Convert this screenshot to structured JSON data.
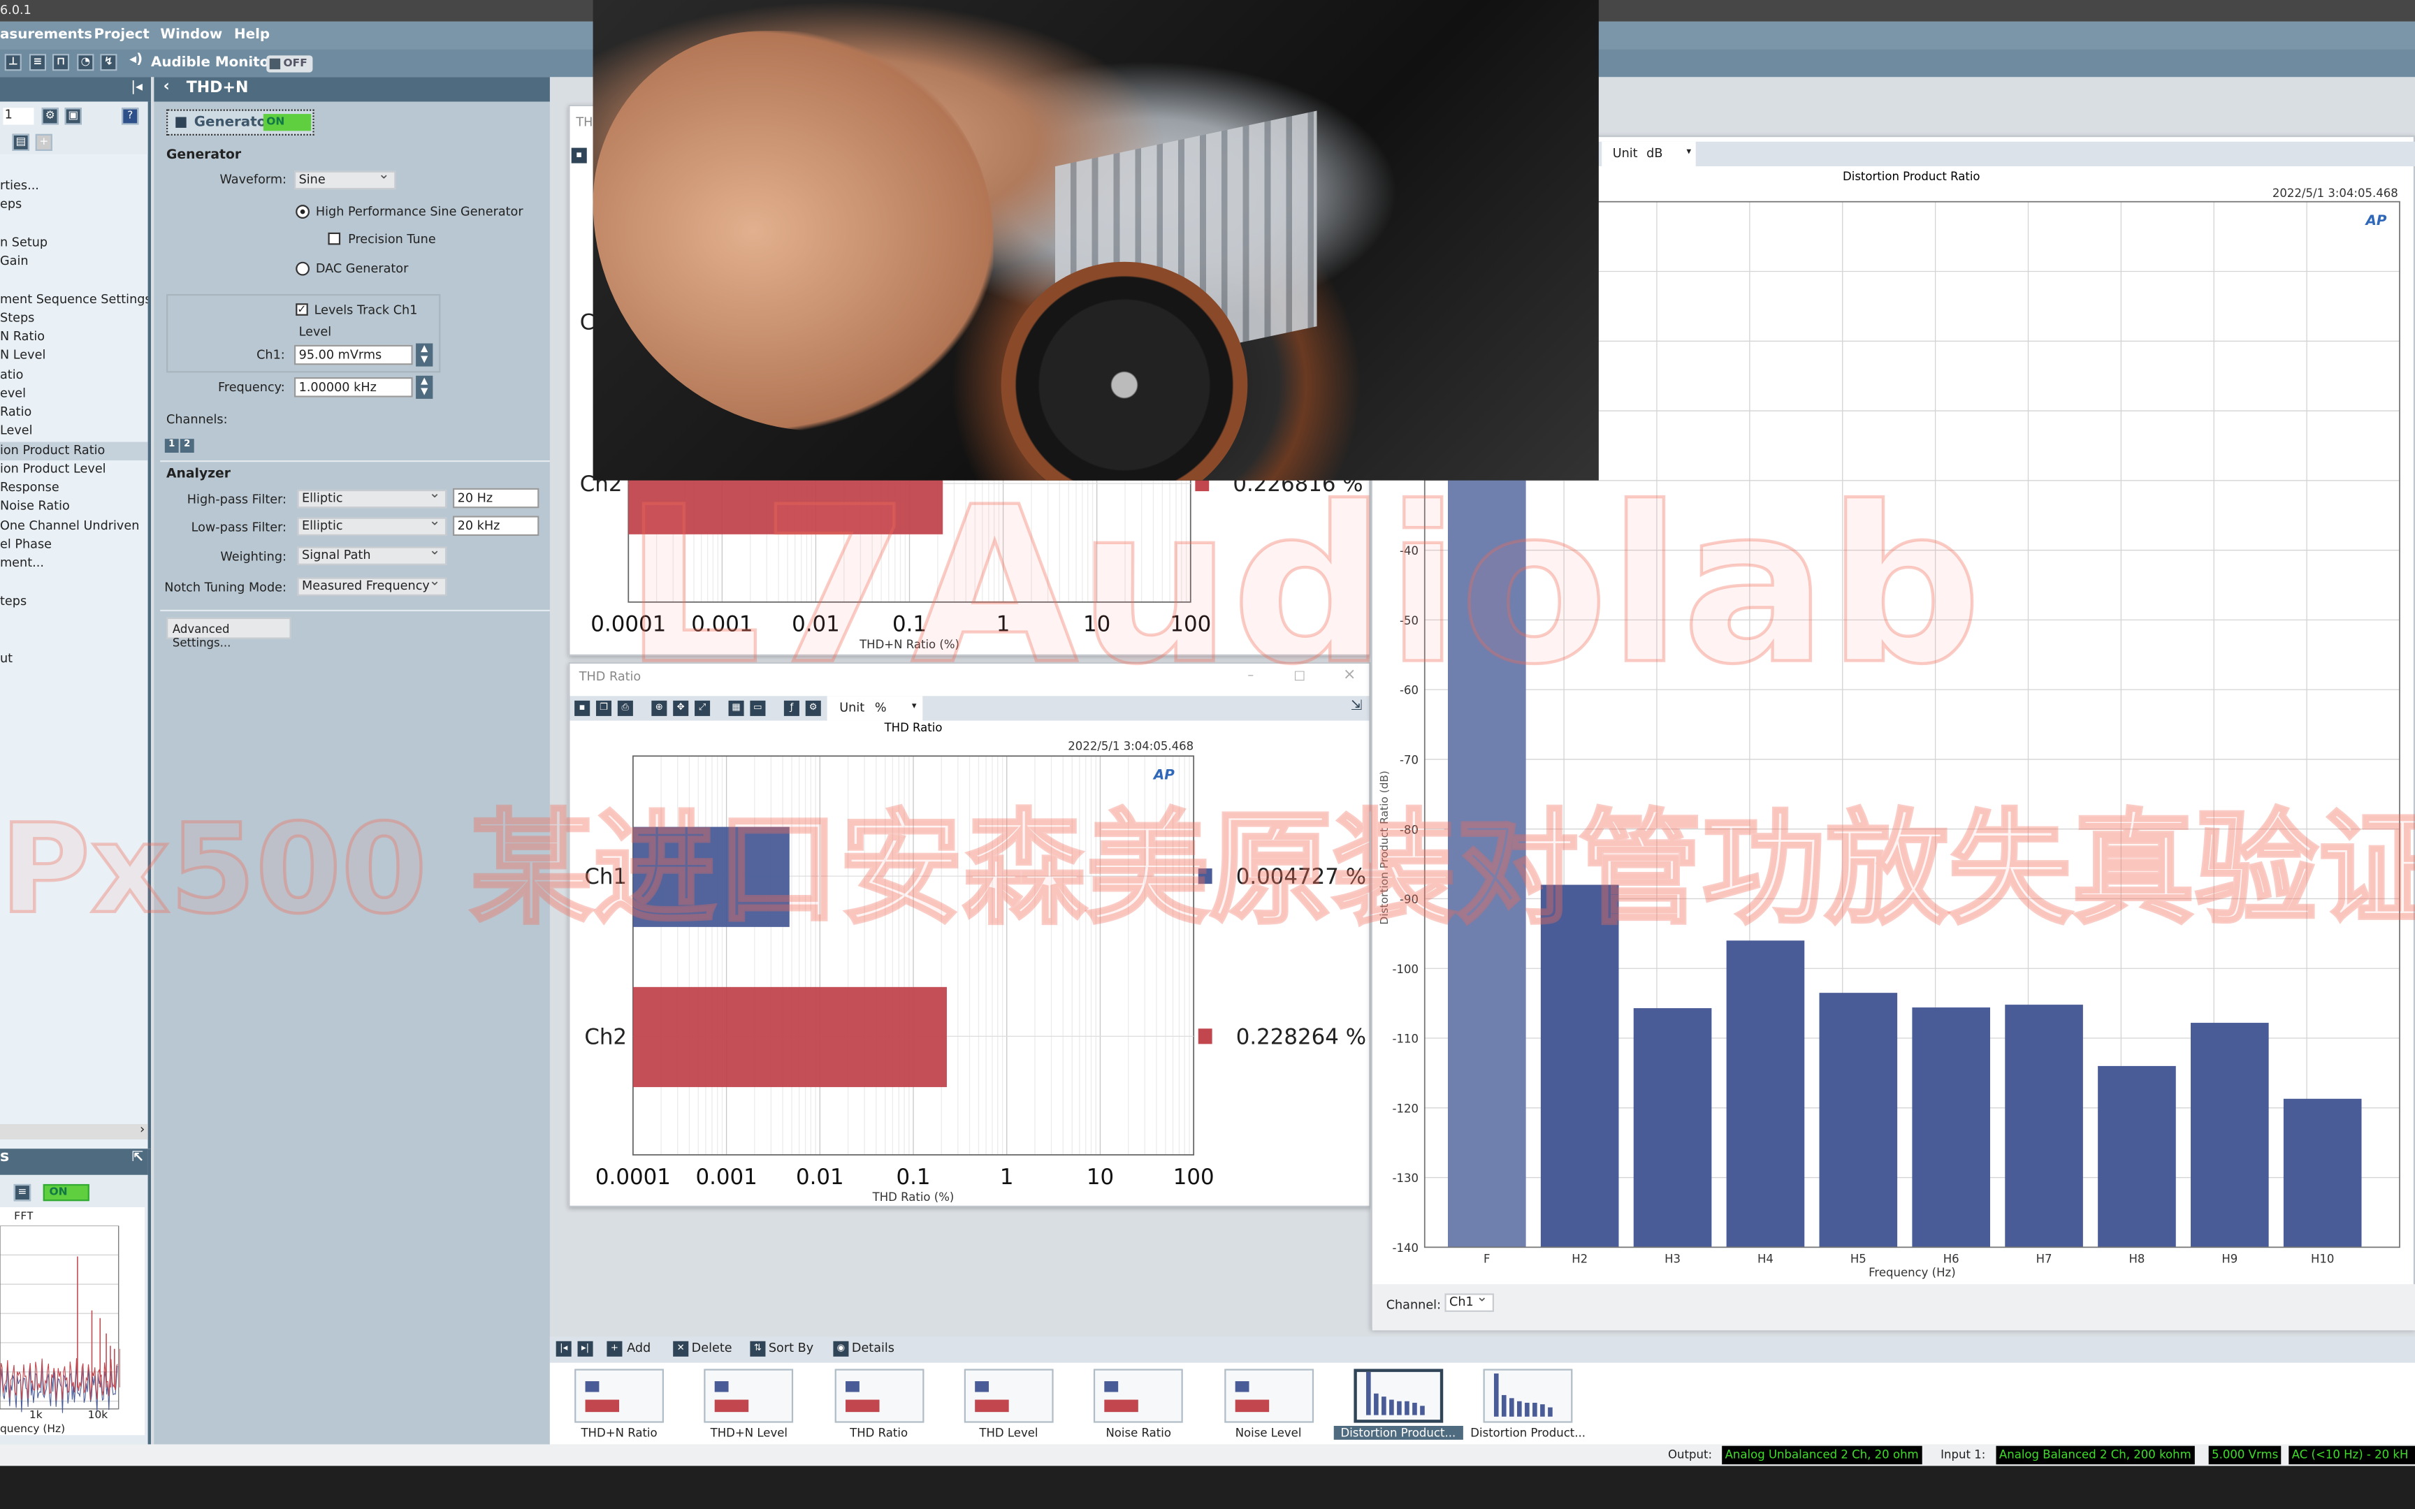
{
  "app": {
    "title": "6.0.1"
  },
  "menu": [
    "asurements",
    "Project",
    "Window",
    "Help"
  ],
  "toolbar": {
    "audible_monitor": "Audible Monitor",
    "audible_toggle": "OFF"
  },
  "sidebar": {
    "items": [
      {
        "label": "rties...",
        "selected": false
      },
      {
        "label": "eps",
        "selected": false
      },
      {
        "label": "n Setup",
        "selected": false
      },
      {
        "label": "Gain",
        "selected": false
      },
      {
        "label": "ment Sequence Settings...",
        "selected": false
      },
      {
        "label": " Steps",
        "selected": false
      },
      {
        "label": "N Ratio",
        "selected": false
      },
      {
        "label": "N Level",
        "selected": false
      },
      {
        "label": "atio",
        "selected": false
      },
      {
        "label": "evel",
        "selected": false
      },
      {
        "label": "Ratio",
        "selected": false
      },
      {
        "label": "Level",
        "selected": false
      },
      {
        "label": "ion Product Ratio",
        "selected": true
      },
      {
        "label": "ion Product Level",
        "selected": false
      },
      {
        "label": " Response",
        "selected": false
      },
      {
        "label": "Noise Ratio",
        "selected": false
      },
      {
        "label": "One Channel Undriven",
        "selected": false
      },
      {
        "label": "el Phase",
        "selected": false
      },
      {
        "label": "ment...",
        "selected": false
      },
      {
        "label": "teps",
        "selected": false
      },
      {
        "label": "ut",
        "selected": false
      }
    ],
    "sequence_number": "1",
    "lower_panel": {
      "title": "s",
      "toggle": "ON",
      "fft_title": "FFT",
      "ticks": [
        "1k",
        "10k"
      ],
      "xlabel": "quency (Hz)"
    }
  },
  "settings": {
    "title": "THD+N",
    "generator_button": "Generator",
    "generator_state": "ON",
    "generator_section": "Generator",
    "waveform_label": "Waveform:",
    "waveform": "Sine",
    "high_perf": "High Performance Sine Generator",
    "precision_tune": "Precision Tune",
    "dac": "DAC Generator",
    "levels_track": "Levels Track Ch1",
    "level_label": "Level",
    "ch1_label": "Ch1:",
    "ch1_value": "95.00 mVrms",
    "freq_label": "Frequency:",
    "freq_value": "1.00000 kHz",
    "channels_label": "Channels:",
    "channels": [
      "1",
      "2"
    ],
    "analyzer_section": "Analyzer",
    "hp_label": "High-pass Filter:",
    "hp_type": "Elliptic",
    "hp_value": "20 Hz",
    "lp_label": "Low-pass Filter:",
    "lp_type": "Elliptic",
    "lp_value": "20 kHz",
    "weighting_label": "Weighting:",
    "weighting": "Signal Path",
    "notch_label": "Notch Tuning Mode:",
    "notch": "Measured Frequency",
    "advanced": "Advanced Settings..."
  },
  "colors": {
    "ch1": "#4a5c97",
    "ch2": "#c2464d",
    "fundamental": "#6f7fae",
    "panel": "#4f6b80",
    "status_green": "#3fdc2a"
  },
  "chart_data": [
    {
      "type": "bar",
      "window_title": "TH",
      "title": "",
      "xlabel": "THD+N Ratio (%)",
      "orientation": "horizontal",
      "xscale": "log",
      "xlim": [
        0.0001,
        100
      ],
      "ticks": [
        "0.0001",
        "0.001",
        "0.01",
        "0.1",
        "1",
        "10",
        "100"
      ],
      "categories": [
        "Ch1",
        "Ch2"
      ],
      "series": [
        {
          "values": [
            null,
            0.226816
          ]
        }
      ],
      "value_labels": [
        "",
        "0.226816 %"
      ]
    },
    {
      "type": "bar",
      "window_title": "THD Ratio",
      "title": "THD Ratio",
      "unit_label": "Unit",
      "unit": "%",
      "timestamp": "2022/5/1 3:04:05.468",
      "xlabel": "THD Ratio (%)",
      "orientation": "horizontal",
      "xscale": "log",
      "xlim": [
        0.0001,
        100
      ],
      "ticks": [
        "0.0001",
        "0.001",
        "0.01",
        "0.1",
        "1",
        "10",
        "100"
      ],
      "categories": [
        "Ch1",
        "Ch2"
      ],
      "series": [
        {
          "values": [
            0.004727,
            0.228264
          ]
        }
      ],
      "value_labels": [
        "0.004727 %",
        "0.228264 %"
      ]
    },
    {
      "type": "bar",
      "title": "Distortion Product Ratio",
      "unit_label": "Unit",
      "unit": "dB",
      "timestamp": "2022/5/1 3:04:05.468",
      "xlabel": "Frequency (Hz)",
      "ylabel": "Distortion Product Ratio (dB)",
      "ylim": [
        -140,
        10
      ],
      "yticks": [
        -40,
        -50,
        -60,
        -70,
        -80,
        -90,
        -100,
        -110,
        -120,
        -130,
        -140
      ],
      "categories": [
        "F",
        "H2",
        "H3",
        "H4",
        "H5",
        "H6",
        "H7",
        "H8",
        "H9",
        "H10"
      ],
      "values": [
        0,
        -88,
        -105.7,
        -96,
        -103.5,
        -105.6,
        -105.2,
        -114,
        -107.8,
        -118.7
      ],
      "grid": true,
      "channel_label": "Channel:",
      "channel": "Ch1"
    }
  ],
  "results_bar": {
    "add": "Add",
    "delete": "Delete",
    "sort_by": "Sort By",
    "details": "Details"
  },
  "thumbnails": [
    {
      "label": "THD+N Ratio",
      "kind": "hbar"
    },
    {
      "label": "THD+N Level",
      "kind": "hbar"
    },
    {
      "label": "THD Ratio",
      "kind": "hbar"
    },
    {
      "label": "THD Level",
      "kind": "hbar"
    },
    {
      "label": "Noise Ratio",
      "kind": "hbar"
    },
    {
      "label": "Noise Level",
      "kind": "hbar"
    },
    {
      "label": "Distortion Product...",
      "kind": "vbar",
      "selected": true
    },
    {
      "label": "Distortion Product...",
      "kind": "vbar"
    }
  ],
  "status": {
    "output_label": "Output:",
    "output": "Analog Unbalanced 2 Ch, 20 ohm",
    "input_label": "Input 1:",
    "input": "Analog Balanced 2 Ch, 200 kohm",
    "range": "5.000 Vrms",
    "coupling": "AC (<10 Hz) - 20 kH"
  },
  "watermark": {
    "brand": "L7Audiolab",
    "caption": "Px500 某进口安森美原装对管功放失真验证"
  }
}
